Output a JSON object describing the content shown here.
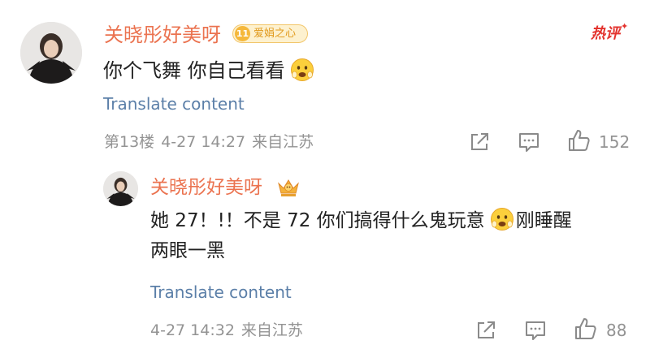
{
  "comment": {
    "username": "关晓彤好美呀",
    "fan_badge": {
      "level": "11",
      "label": "爱娟之心"
    },
    "hot_tag": "热评",
    "text": "你个飞舞 你自己看看",
    "translate_label": "Translate content",
    "floor": "第13楼",
    "time": "4-27 14:27",
    "location": "来自江苏",
    "like_count": "152"
  },
  "reply": {
    "username": "关晓彤好美呀",
    "text_line1": "她 27！!！不是 72 你们搞得什么鬼玩意",
    "text_line1_after_emoji": "刚睡醒",
    "text_line2": "两眼一黑",
    "translate_label": "Translate content",
    "time": "4-27 14:32",
    "location": "来自江苏",
    "like_count": "88"
  },
  "colors": {
    "username": "#eb7350",
    "link": "#5b7fa8",
    "meta": "#939393",
    "hot": "#e3332e"
  },
  "icons": [
    "share-icon",
    "comment-icon",
    "like-icon",
    "crown-icon",
    "emoji-icon"
  ]
}
